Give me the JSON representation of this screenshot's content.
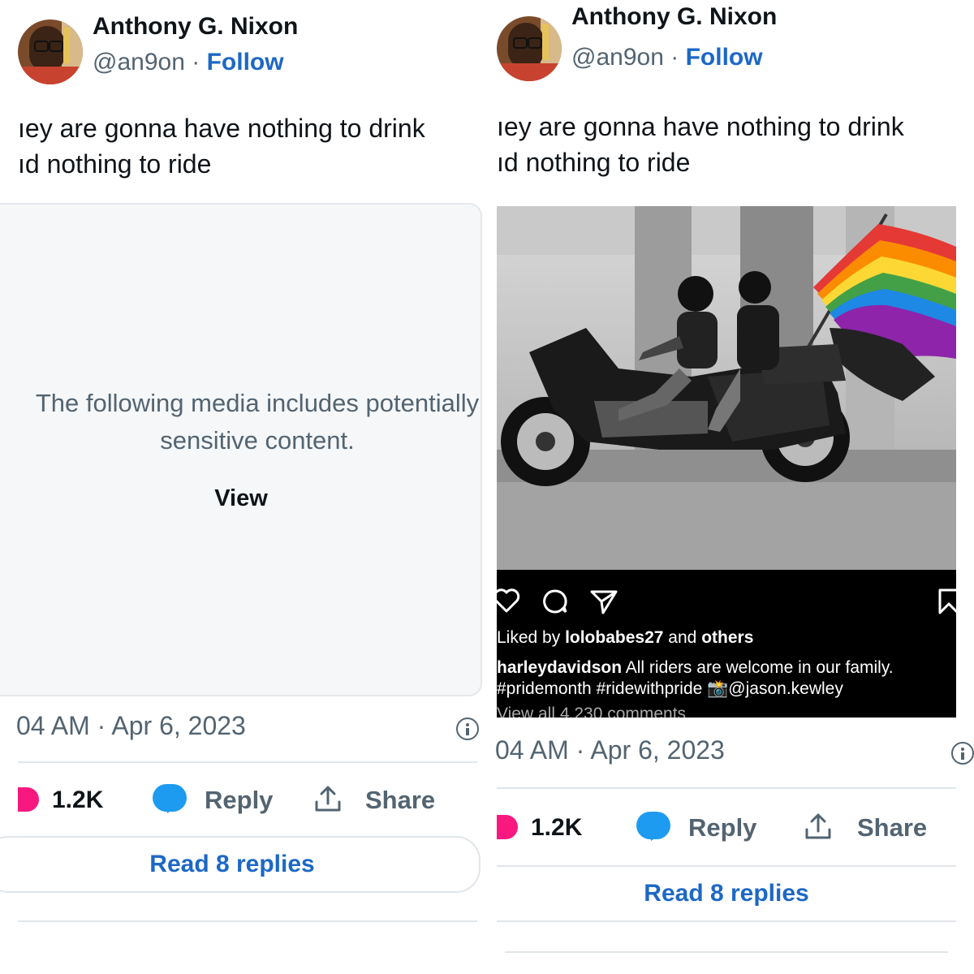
{
  "left": {
    "author_name": "Anthony G. Nixon",
    "handle": "@an9on",
    "separator": "·",
    "follow_label": "Follow",
    "text_line1": "ıey are gonna have nothing to drink",
    "text_line2": "ıd nothing to ride",
    "sensitive_message": "The following media includes potentially sensitive content.",
    "view_label": "View",
    "timestamp": "04 AM · Apr 6, 2023",
    "like_count": "1.2K",
    "reply_label": "Reply",
    "share_label": "Share",
    "read_replies_label": "Read 8 replies"
  },
  "right": {
    "author_name": "Anthony G. Nixon",
    "handle": "@an9on",
    "separator": "·",
    "follow_label": "Follow",
    "text_line1": "ıey are gonna have nothing to drink",
    "text_line2": "ıd nothing to ride",
    "ig_liked_prefix": "Liked by",
    "ig_liked_user": "lolobabes27",
    "ig_liked_and": "and",
    "ig_liked_others": "others",
    "ig_caption_user": "harleydavidson",
    "ig_caption_text": "All riders are welcome in our family.",
    "ig_caption_tags": "#pridemonth #ridewithpride 📸@jason.kewley",
    "ig_view_all": "View all 4,230 comments",
    "timestamp": "04 AM · Apr 6, 2023",
    "like_count": "1.2K",
    "reply_label": "Reply",
    "share_label": "Share",
    "read_replies_label": "Read 8 replies"
  },
  "colors": {
    "follow": "#1d68c5",
    "heart": "#f91880",
    "bubble": "#1d9bf0",
    "muted": "#536471",
    "sensitive_bg": "#f5f7f9"
  }
}
